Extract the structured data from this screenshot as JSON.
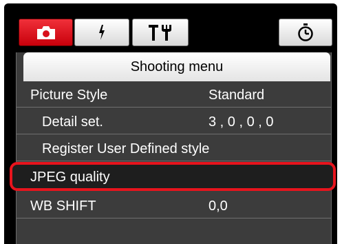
{
  "tabs": [
    {
      "icon": "camera-icon",
      "active": true
    },
    {
      "icon": "flash-icon",
      "active": false
    },
    {
      "icon": "tools-icon",
      "active": false
    },
    {
      "icon": "timer-icon",
      "active": false
    }
  ],
  "menu": {
    "title": "Shooting menu",
    "items": [
      {
        "label": "Picture Style",
        "value": "Standard"
      },
      {
        "label": "Detail set.",
        "value": "3 , 0 , 0 , 0"
      },
      {
        "label": "Register User Defined style",
        "value": ""
      },
      {
        "label": "JPEG quality",
        "value": ""
      },
      {
        "label": "WB SHIFT",
        "value": "0,0"
      }
    ]
  },
  "colors": {
    "active_tab": "#d8101b",
    "highlight": "#e8141d",
    "panel_bg": "#3c3c3c"
  }
}
